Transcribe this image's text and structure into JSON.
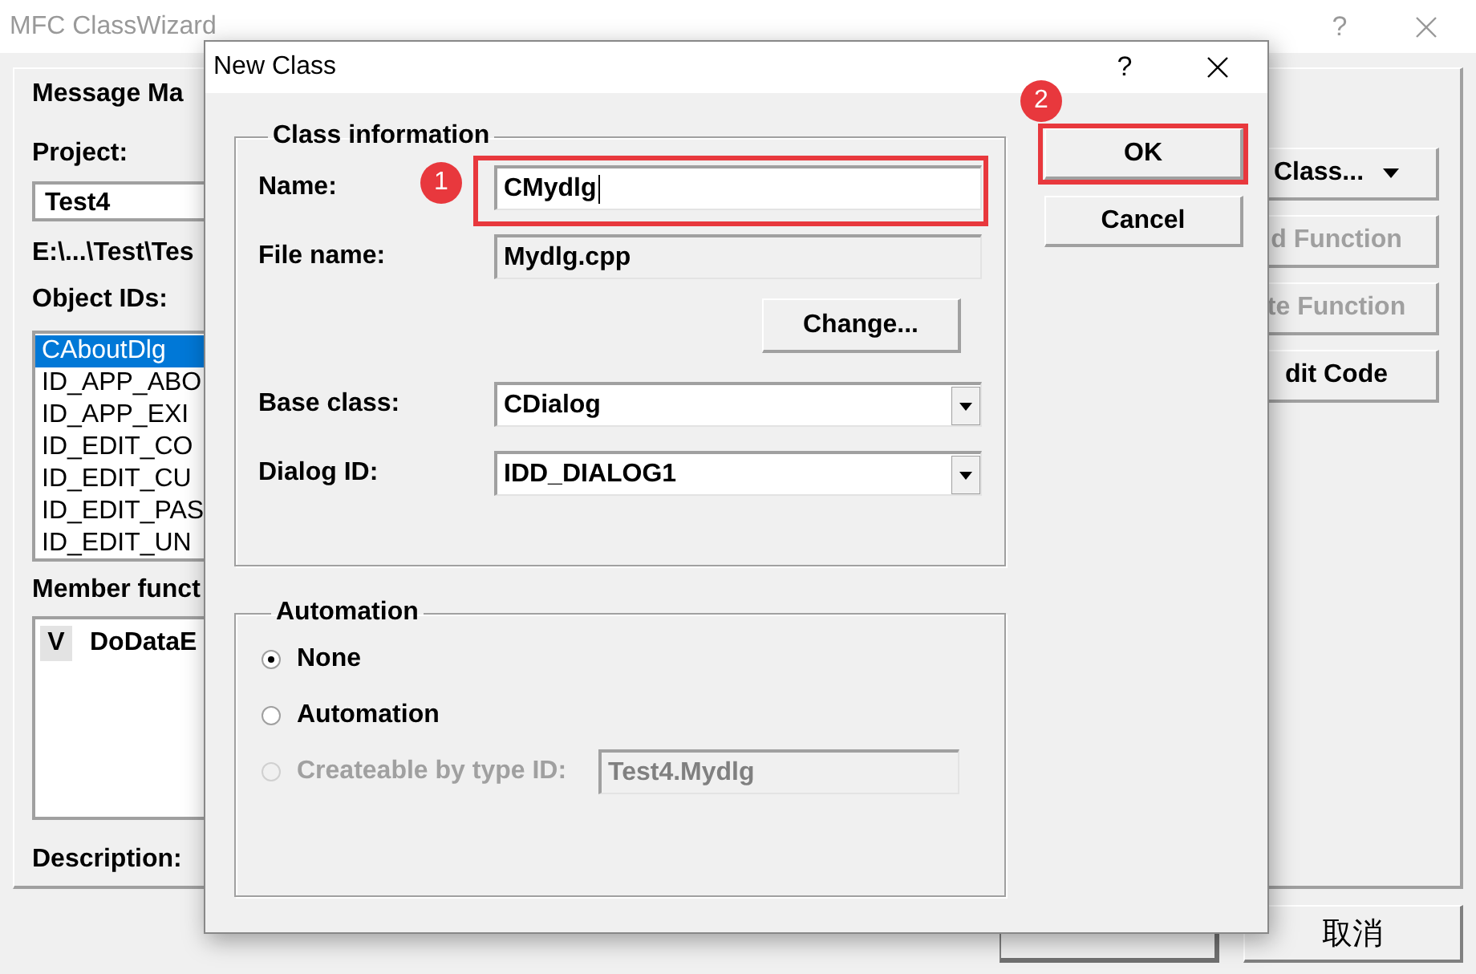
{
  "background_window": {
    "title": "MFC ClassWizard",
    "help_button": "?",
    "tab": "Message Ma",
    "project_label": "Project:",
    "project_value": "Test4",
    "path": "E:\\...\\Test\\Tes",
    "object_ids_label": "Object IDs:",
    "object_ids": [
      {
        "label": "CAboutDlg",
        "selected": true
      },
      {
        "label": "ID_APP_ABO",
        "selected": false
      },
      {
        "label": "ID_APP_EXI",
        "selected": false
      },
      {
        "label": "ID_EDIT_CO",
        "selected": false
      },
      {
        "label": "ID_EDIT_CU",
        "selected": false
      },
      {
        "label": "ID_EDIT_PAS",
        "selected": false
      },
      {
        "label": "ID_EDIT_UN",
        "selected": false
      }
    ],
    "member_functions_label": "Member funct",
    "member_functions": [
      {
        "marker": "V",
        "name": "DoDataE"
      }
    ],
    "description_label": "Description:",
    "side_buttons": [
      {
        "label": "Class...",
        "disabled": false,
        "dropdown": true
      },
      {
        "label": "d Function",
        "disabled": true,
        "dropdown": false
      },
      {
        "label": "te Function",
        "disabled": true,
        "dropdown": false
      },
      {
        "label": "dit Code",
        "disabled": false,
        "dropdown": false
      }
    ],
    "buttons": [
      {
        "kind": "default"
      },
      {
        "kind": "normal",
        "label": "取消"
      }
    ]
  },
  "dialog": {
    "title": "New Class",
    "help_button": "?",
    "class_information": {
      "title": "Class information",
      "fields": [
        {
          "kind": "edit",
          "label": "Name:",
          "value": "CMydlg",
          "readonly": false,
          "callout": "1"
        },
        {
          "kind": "edit",
          "label": "File name:",
          "value": "Mydlg.cpp",
          "readonly": true
        },
        {
          "kind": "button",
          "label": "Change..."
        },
        {
          "kind": "combo",
          "label": "Base class:",
          "value": "CDialog"
        },
        {
          "kind": "combo",
          "label": "Dialog ID:",
          "value": "IDD_DIALOG1"
        }
      ]
    },
    "automation": {
      "title": "Automation",
      "options": [
        {
          "label": "None",
          "selected": true,
          "disabled": false
        },
        {
          "label": "Automation",
          "selected": false,
          "disabled": false
        },
        {
          "label": "Createable by type ID:",
          "selected": false,
          "disabled": true,
          "field_value": "Test4.Mydlg"
        }
      ]
    },
    "buttons": [
      {
        "label": "OK",
        "callout": "2"
      },
      {
        "label": "Cancel"
      }
    ]
  }
}
